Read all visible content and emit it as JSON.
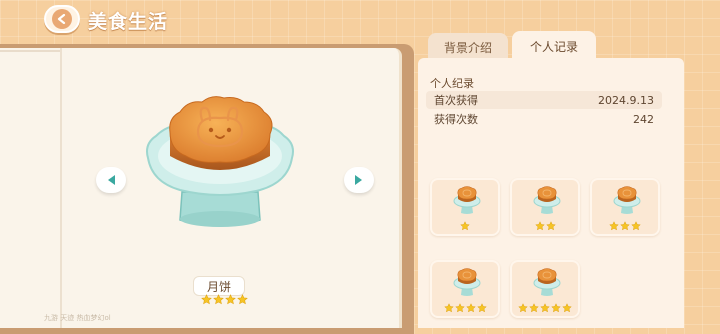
{
  "header": {
    "title": "美食生活",
    "back_icon": "back-arrow-icon"
  },
  "tabs": [
    {
      "label": "背景介绍",
      "active": false
    },
    {
      "label": "个人记录",
      "active": true
    }
  ],
  "record": {
    "heading": "个人纪录",
    "rows": [
      {
        "label": "首次获得",
        "value": "2024.9.13"
      },
      {
        "label": "获得次数",
        "value": "242"
      }
    ]
  },
  "item": {
    "name": "月饼",
    "stars": 4
  },
  "variants": [
    {
      "stars": 1
    },
    {
      "stars": 2
    },
    {
      "stars": 3
    },
    {
      "stars": 4
    },
    {
      "stars": 5
    }
  ],
  "colors": {
    "background": "#f6cf9e",
    "panel": "#fdf2e6",
    "star": "#f6c425",
    "nav": "#3aa8a0"
  },
  "footer": "九游 天迹 热血梦幻ol"
}
